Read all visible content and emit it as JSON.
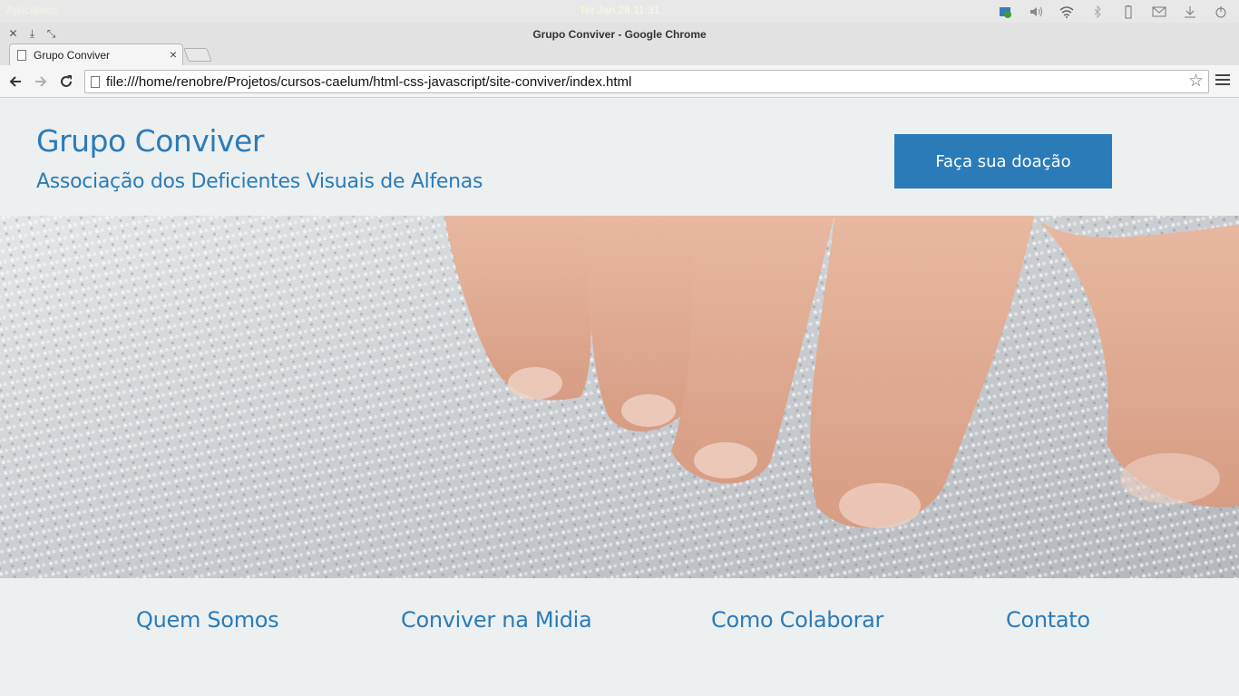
{
  "system_panel": {
    "apps_label": "Aplicativos",
    "clock": "Ter Jan 28 11:31",
    "tray_icons": [
      "network-status-icon",
      "volume-icon",
      "wifi-icon",
      "bluetooth-icon",
      "battery-icon",
      "mail-icon",
      "download-icon",
      "power-icon"
    ]
  },
  "window": {
    "title": "Grupo Conviver - Google Chrome",
    "controls": [
      "close",
      "minimize",
      "restore"
    ]
  },
  "browser": {
    "tab_label": "Grupo Conviver",
    "tab_close": "×",
    "url": "file:///home/renobre/Projetos/cursos-caelum/html-css-javascript/site-conviver/index.html",
    "star": "☆"
  },
  "site": {
    "title": "Grupo Conviver",
    "subtitle": "Associação dos Deficientes Visuais de Alfenas",
    "donate_label": "Faça sua doação",
    "nav": [
      "Quem Somos",
      "Conviver na Midia",
      "Como Colaborar",
      "Contato"
    ]
  },
  "colors": {
    "accent": "#2b7bb9",
    "page_background": "#edf0f1"
  }
}
